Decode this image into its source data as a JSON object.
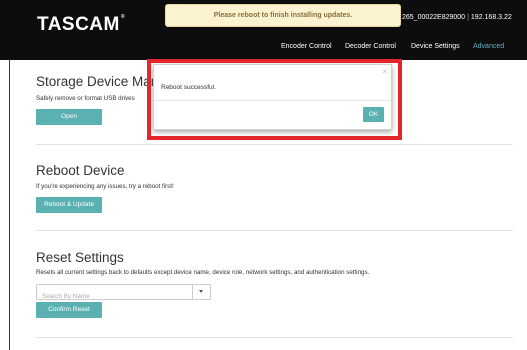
{
  "header": {
    "logo": "TASCAM",
    "logo_mark": "®",
    "notice": "Please reboot to finish installing updates.",
    "device_name": "265_00022E829000",
    "ip_address": "192.168.3.22"
  },
  "nav": {
    "items": [
      {
        "label": "Encoder Control",
        "active": false
      },
      {
        "label": "Decoder Control",
        "active": false
      },
      {
        "label": "Device Settings",
        "active": false
      },
      {
        "label": "Advanced",
        "active": true
      }
    ]
  },
  "storage": {
    "title": "Storage Device Manag",
    "desc": "Safely remove or format USB drives",
    "button": "Open"
  },
  "reboot": {
    "title": "Reboot Device",
    "desc": "If you're experiencing any issues, try a reboot first!",
    "button": "Reboot & Update"
  },
  "reset": {
    "title": "Reset Settings",
    "desc": "Resets all current settings back to defaults except device name, device role, network settings, and authentication settings.",
    "search_placeholder": "Search By Name",
    "button": "Confirm Reset"
  },
  "modal": {
    "close": "×",
    "message": "Reboot successful.",
    "ok": "OK"
  },
  "colors": {
    "accent": "#5bb1b1",
    "highlight": "#e3262c",
    "nav_active": "#5fb3c6"
  }
}
